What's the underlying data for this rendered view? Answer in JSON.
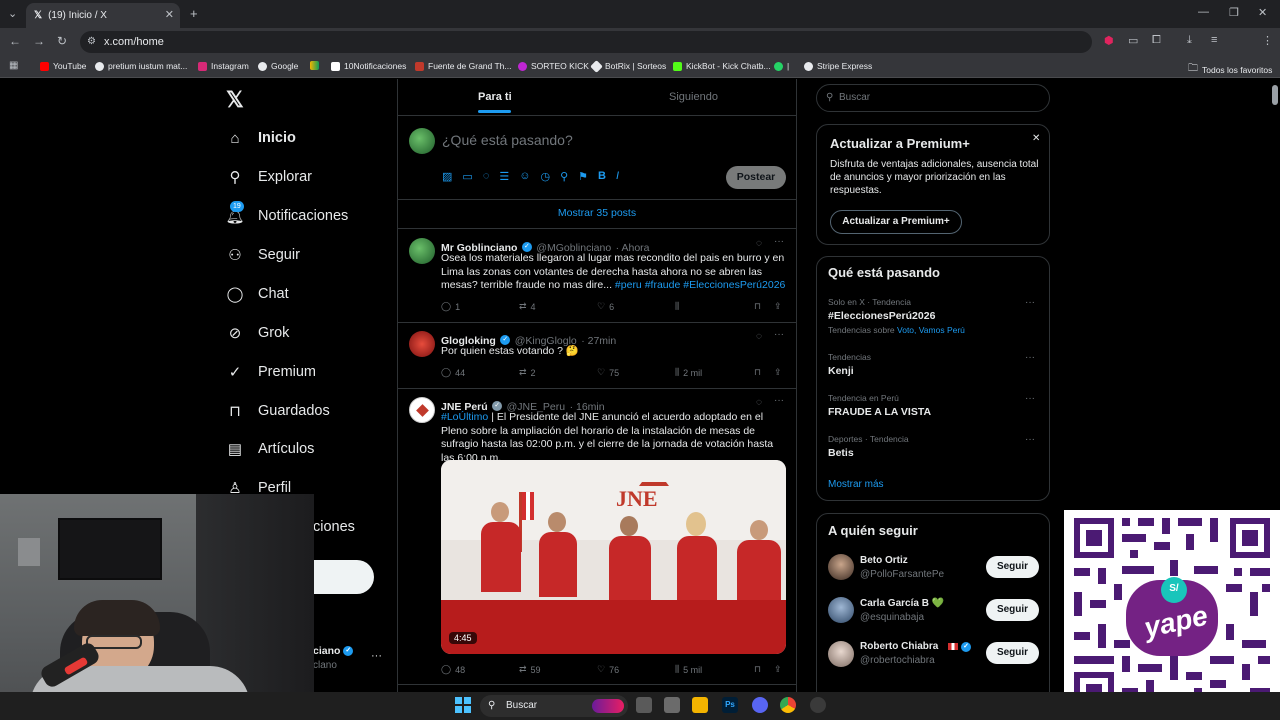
{
  "browser": {
    "tab_title": "(19) Inicio / X",
    "url": "x.com/home",
    "bookmarks": [
      "YouTube",
      "pretium iustum mat...",
      "Instagram",
      "Google",
      "10Notificaciones",
      "Fuente de Grand Th...",
      "SORTEO KICK",
      "BotRix | Sorteos",
      "KickBot - Kick Chatb...",
      "|",
      "Stripe Express"
    ],
    "all_bookmarks": "Todos los favoritos"
  },
  "nav": {
    "items": [
      {
        "label": "Inicio",
        "icon": "home-icon"
      },
      {
        "label": "Explorar",
        "icon": "search-icon"
      },
      {
        "label": "Notificaciones",
        "icon": "bell-icon",
        "badge": "19"
      },
      {
        "label": "Seguir",
        "icon": "add-person-icon"
      },
      {
        "label": "Chat",
        "icon": "chat-icon"
      },
      {
        "label": "Grok",
        "icon": "grok-icon"
      },
      {
        "label": "Premium",
        "icon": "premium-icon"
      },
      {
        "label": "Guardados",
        "icon": "bookmark-icon"
      },
      {
        "label": "Artículos",
        "icon": "articles-icon"
      },
      {
        "label": "Perfil",
        "icon": "person-icon"
      }
    ],
    "partial_more": "ciones",
    "partial_post_button": "r",
    "profile_name_partial": "ciano",
    "profile_handle_partial": "clano",
    "more_dots": "···"
  },
  "timeline": {
    "tabs": [
      "Para ti",
      "Siguiendo"
    ],
    "composer_placeholder": "¿Qué está pasando?",
    "post_button": "Postear",
    "show_posts": "Mostrar 35 posts",
    "tweets": [
      {
        "name": "Mr Goblinciano",
        "handle": "@MGoblinciano",
        "time": "· Ahora",
        "text": "Osea los materiales llegaron al lugar mas recondito del pais en burro y en Lima las zonas con votantes de derecha hasta ahora no se abren las mesas? terrible fraude no mas dire...",
        "tags": "#peru #fraude #EleccionesPerú2026",
        "replies": "1",
        "reposts": "4",
        "likes": "6",
        "views": ""
      },
      {
        "name": "Glogloking",
        "handle": "@KingGloglo",
        "time": "· 27min",
        "text": "Por quien estas votando ? 🤔",
        "tags": "",
        "replies": "44",
        "reposts": "2",
        "likes": "75",
        "views": "2 mil"
      },
      {
        "name": "JNE Perú",
        "handle": "@JNE_Peru",
        "time": "· 16min",
        "lead_tag": "#LoÚltimo",
        "text": " | El Presidente del JNE anunció el acuerdo adoptado en el Pleno sobre la ampliación del horario de la instalación de mesas de sufragio hasta las 02:00 p.m. y el cierre de la jornada de votación hasta las 6:00 p.m.",
        "video_duration": "4:45",
        "video_logo": "JNE",
        "replies": "48",
        "reposts": "59",
        "likes": "76",
        "views": "5 mil"
      }
    ]
  },
  "sidebar": {
    "search_placeholder": "Buscar",
    "premium": {
      "title": "Actualizar a Premium+",
      "body": "Disfruta de ventajas adicionales, ausencia total de anuncios y mayor priorización en las respuestas.",
      "button": "Actualizar a Premium+"
    },
    "trends": {
      "title": "Qué está pasando",
      "items": [
        {
          "meta": "Solo en X · Tendencia",
          "title": "#EleccionesPerú2026",
          "sub": "Tendencias sobre",
          "sub_links": "Voto, Vamos Perú"
        },
        {
          "meta": "Tendencias",
          "title": "Kenji",
          "sub": "",
          "sub_links": ""
        },
        {
          "meta": "Tendencia en Perú",
          "title": "FRAUDE A LA VISTA",
          "sub": "",
          "sub_links": ""
        },
        {
          "meta": "Deportes · Tendencia",
          "title": "Betis",
          "sub": "",
          "sub_links": ""
        }
      ],
      "show_more": "Mostrar más"
    },
    "who_to_follow": {
      "title": "A quién seguir",
      "items": [
        {
          "name": "Beto Ortiz",
          "handle": "@PolloFarsantePe",
          "button": "Seguir"
        },
        {
          "name": "Carla García B 💚",
          "handle": "@esquinabaja",
          "button": "Seguir"
        },
        {
          "name": "Roberto Chiabra",
          "handle": "@robertochiabra",
          "button": "Seguir"
        }
      ]
    }
  },
  "taskbar": {
    "search_label": "Buscar"
  },
  "overlay": {
    "qr_brand": "yape",
    "qr_badge": "S/"
  }
}
